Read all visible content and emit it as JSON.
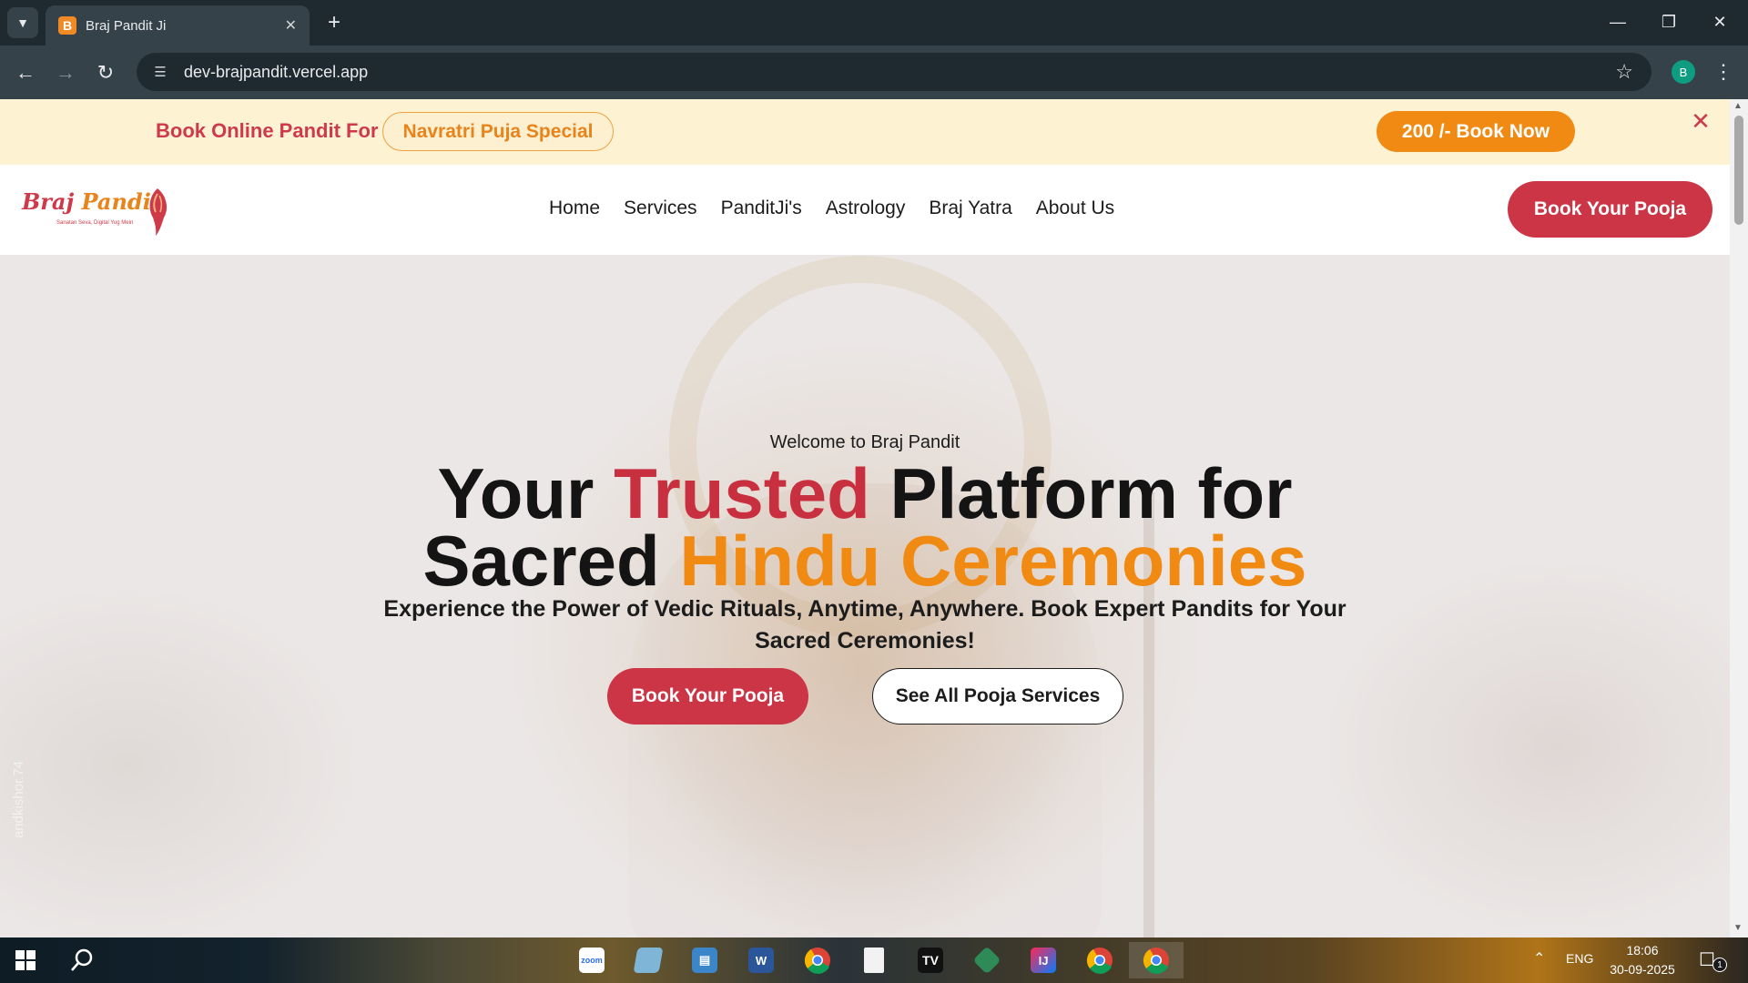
{
  "browser": {
    "tab_title": "Braj Pandit Ji",
    "tab_favicon_letter": "B",
    "url": "dev-brajpandit.vercel.app",
    "profile_initial": "B"
  },
  "announcement": {
    "text": "Book Online Pandit For",
    "pill": "Navratri Puja Special",
    "cta": "200 /- Book Now"
  },
  "header": {
    "logo_word_1": "Braj",
    "logo_word_2": "Pandit",
    "logo_tagline": "Sanatan Seva, Digital Yug Mein",
    "nav": [
      "Home",
      "Services",
      "PanditJi's",
      "Astrology",
      "Braj Yatra",
      "About Us"
    ],
    "cta": "Book Your Pooja"
  },
  "hero": {
    "eyebrow": "Welcome to Braj Pandit",
    "title_part_1": "Your ",
    "title_highlight_1": "Trusted",
    "title_part_2": " Platform for",
    "title_part_3": "Sacred ",
    "title_highlight_2": "Hindu Ceremonies",
    "subtitle": "Experience the Power of Vedic Rituals, Anytime, Anywhere. Book Expert Pandits for Your Sacred Ceremonies!",
    "primary_cta": "Book Your Pooja",
    "secondary_cta": "See All Pooja Services",
    "watermark": "andkishor.74"
  },
  "taskbar": {
    "apps": [
      "start",
      "search",
      "zoom",
      "notepad-plus",
      "my-computer",
      "word",
      "chrome",
      "file",
      "tradingview",
      "git",
      "intellij",
      "chrome-profile",
      "chrome-active"
    ],
    "language": "ENG",
    "time": "18:06",
    "date": "30-09-2025",
    "notifications": "1"
  },
  "colors": {
    "brand_red": "#cb3545",
    "brand_orange": "#f08a12",
    "announce_bg": "#fdf3d3"
  }
}
